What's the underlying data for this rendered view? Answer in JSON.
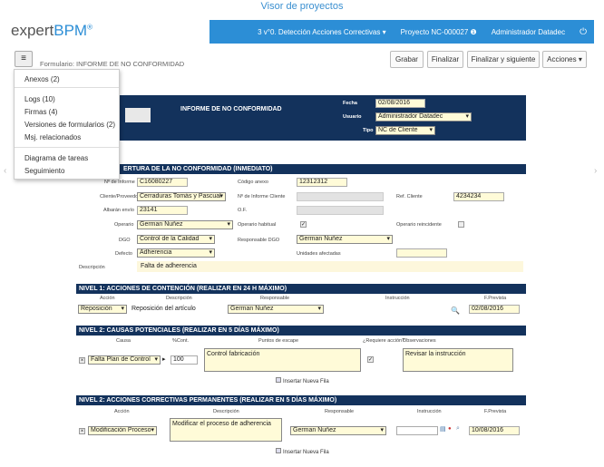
{
  "caption": "Visor de proyectos",
  "logo": {
    "expert": "expert",
    "bpm": "BPM",
    "mark": "®"
  },
  "topbar": {
    "process": "3 v°0. Detección Acciones Correctivas ▾",
    "project": "Proyecto NC-000027 ❶",
    "user": "Administrador Datadec",
    "power_icon": "⏻"
  },
  "form": {
    "title": "Formulario: INFORME DE NO CONFORMIDAD"
  },
  "toolbar": {
    "save": "Grabar",
    "finish": "Finalizar",
    "finish_next": "Finalizar y siguiente",
    "actions": "Acciones ▾"
  },
  "menu": {
    "items": [
      "Anexos (2)",
      "Logs (10)",
      "Firmas (4)",
      "Versiones de formularios (2)",
      "Msj. relacionados",
      "Diagrama de tareas",
      "Seguimiento"
    ]
  },
  "header": {
    "title": "INFORME DE NO CONFORMIDAD",
    "fecha_label": "Fecha",
    "fecha": "02/08/2016",
    "usuario_label": "Usuario",
    "usuario": "Administrador Datadec",
    "tipo_label": "Tipo",
    "tipo": "NC de Cliente"
  },
  "apertura": {
    "title": "ERTURA DE LA NO CONFORMIDAD (INMEDIATO)",
    "n_informe_label": "Nº de Informe",
    "n_informe": "C16080227",
    "codigo_label": "Código anexo",
    "codigo": "12312312",
    "cliente_label": "Cliente/Proveedor",
    "cliente": "Cerraduras Tomás y Pascual",
    "n_inf_cliente_label": "Nº de Informe Cliente",
    "ref_cliente_label": "Ref. Cliente",
    "ref_cliente": "4234234",
    "albaran_label": "Albarán envío",
    "albaran": "23141",
    "of_label": "O.F.",
    "operario_label": "Operario",
    "operario": "German Nuñez",
    "habitual_label": "Operario habitual",
    "reincidente_label": "Operario reincidente",
    "dgo_label": "DGO",
    "dgo": "Control de la Calidad",
    "resp_dgo_label": "Responsable DGO",
    "resp_dgo": "German Nuñez",
    "defecto_label": "Defecto",
    "defecto": "Adherencia",
    "unidades_label": "Unidades afectadas",
    "descripcion_label": "Descripción",
    "descripcion": "Falta de adherencia"
  },
  "nivel1": {
    "title": "NIVEL 1: ACCIONES DE CONTENCIÓN (REALIZAR EN 24 H MÁXIMO)",
    "cols": [
      "Acción",
      "Descripción",
      "Responsable",
      "Instrucción",
      "F.Prevista"
    ],
    "accion": "Reposición",
    "descripcion": "Reposición del artículo",
    "responsable": "German Nuñez",
    "fecha": "02/08/2016"
  },
  "nivel2a": {
    "title": "NIVEL 2: CAUSAS POTENCIALES (REALIZAR EN 5 DÍAS MÁXIMO)",
    "cols": [
      "Causa",
      "%Cont.",
      "Puntos de escape",
      "¿Requiere acción?",
      "Observaciones"
    ],
    "causa": "Falta Plan de Control",
    "pct": "100",
    "puntos": "Control fabricación",
    "obs": "Revisar la instrucción",
    "add": "Insertar Nueva Fila"
  },
  "nivel2b": {
    "title": "NIVEL 2: ACCIONES CORRECTIVAS PERMANENTES (REALIZAR EN 5 DÍAS MÁXIMO)",
    "cols": [
      "Acción",
      "Descripción",
      "Responsable",
      "Instrucción",
      "F.Prevista"
    ],
    "accion": "Modificación Proceso",
    "descripcion": "Modificar el proceso de adherencia",
    "responsable": "German Nuñez",
    "fecha": "10/08/2016",
    "add": "Insertar Nueva Fila"
  }
}
